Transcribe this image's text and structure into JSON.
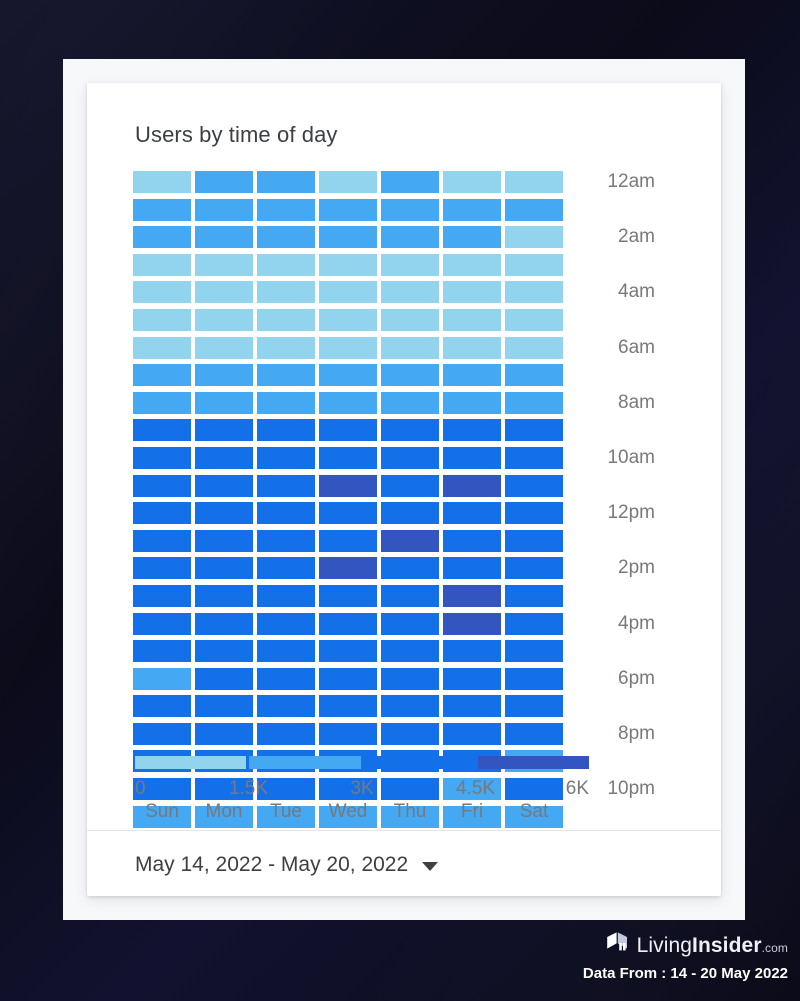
{
  "card": {
    "title": "Users by time of day",
    "date_range_label": "May 14, 2022 - May 20, 2022",
    "caret_icon": "chevron-down-icon"
  },
  "brand": {
    "logo_icon": "living-insider-cube-logo",
    "name_part1": "Living",
    "name_part2": "Insider",
    "name_suffix": ".com",
    "data_from": "Data From : 14 - 20 May 2022"
  },
  "colors": {
    "background": "#0c0c1e",
    "frame": "#f7f8fa",
    "card": "#ffffff",
    "title_text": "#3c4043",
    "axis_text": "#77797c",
    "bucket_1": "#92d3ed",
    "bucket_2": "#44a8f2",
    "bucket_3": "#1470e8",
    "bucket_4": "#3355c0"
  },
  "chart_data": {
    "type": "heatmap",
    "title": "Users by time of day",
    "xlabel": "",
    "ylabel": "",
    "x_categories": [
      "Sun",
      "Mon",
      "Tue",
      "Wed",
      "Thu",
      "Fri",
      "Sat"
    ],
    "y_categories": [
      "12am",
      "1am",
      "2am",
      "3am",
      "4am",
      "5am",
      "6am",
      "7am",
      "8am",
      "9am",
      "10am",
      "11am",
      "12pm",
      "1pm",
      "2pm",
      "3pm",
      "4pm",
      "5pm",
      "6pm",
      "7pm",
      "8pm",
      "9pm",
      "10pm",
      "11pm"
    ],
    "y_tick_labels": [
      "12am",
      "",
      "2am",
      "",
      "4am",
      "",
      "6am",
      "",
      "8am",
      "",
      "10am",
      "",
      "12pm",
      "",
      "2pm",
      "",
      "4pm",
      "",
      "6pm",
      "",
      "8pm",
      "",
      "10pm",
      ""
    ],
    "legend": {
      "position": "bottom",
      "ticks": [
        "0",
        "1.5K",
        "3K",
        "4.5K",
        "6K"
      ],
      "band_colors": [
        "#92d3ed",
        "#44a8f2",
        "#1470e8",
        "#3355c0"
      ],
      "band_ranges": [
        [
          0,
          1500
        ],
        [
          1500,
          3000
        ],
        [
          3000,
          4500
        ],
        [
          4500,
          6000
        ]
      ]
    },
    "value_bucket_scale": [
      1,
      2,
      3,
      4
    ],
    "bucket_colors": [
      "#92d3ed",
      "#44a8f2",
      "#1470e8",
      "#3355c0"
    ],
    "rows": [
      {
        "hour": "12am",
        "buckets": [
          1,
          2,
          2,
          1,
          2,
          1,
          1
        ]
      },
      {
        "hour": "1am",
        "buckets": [
          2,
          2,
          2,
          2,
          2,
          2,
          2
        ]
      },
      {
        "hour": "2am",
        "buckets": [
          2,
          2,
          2,
          2,
          2,
          2,
          1
        ]
      },
      {
        "hour": "3am",
        "buckets": [
          1,
          1,
          1,
          1,
          1,
          1,
          1
        ]
      },
      {
        "hour": "4am",
        "buckets": [
          1,
          1,
          1,
          1,
          1,
          1,
          1
        ]
      },
      {
        "hour": "5am",
        "buckets": [
          1,
          1,
          1,
          1,
          1,
          1,
          1
        ]
      },
      {
        "hour": "6am",
        "buckets": [
          1,
          1,
          1,
          1,
          1,
          1,
          1
        ]
      },
      {
        "hour": "7am",
        "buckets": [
          2,
          2,
          2,
          2,
          2,
          2,
          2
        ]
      },
      {
        "hour": "8am",
        "buckets": [
          2,
          2,
          2,
          2,
          2,
          2,
          2
        ]
      },
      {
        "hour": "9am",
        "buckets": [
          3,
          3,
          3,
          3,
          3,
          3,
          3
        ]
      },
      {
        "hour": "10am",
        "buckets": [
          3,
          3,
          3,
          3,
          3,
          3,
          3
        ]
      },
      {
        "hour": "11am",
        "buckets": [
          3,
          3,
          3,
          4,
          3,
          4,
          3
        ]
      },
      {
        "hour": "12pm",
        "buckets": [
          3,
          3,
          3,
          3,
          3,
          3,
          3
        ]
      },
      {
        "hour": "1pm",
        "buckets": [
          3,
          3,
          3,
          3,
          4,
          3,
          3
        ]
      },
      {
        "hour": "2pm",
        "buckets": [
          3,
          3,
          3,
          4,
          3,
          3,
          3
        ]
      },
      {
        "hour": "3pm",
        "buckets": [
          3,
          3,
          3,
          3,
          3,
          4,
          3
        ]
      },
      {
        "hour": "4pm",
        "buckets": [
          3,
          3,
          3,
          3,
          3,
          4,
          3
        ]
      },
      {
        "hour": "5pm",
        "buckets": [
          3,
          3,
          3,
          3,
          3,
          3,
          3
        ]
      },
      {
        "hour": "6pm",
        "buckets": [
          2,
          3,
          3,
          3,
          3,
          3,
          3
        ]
      },
      {
        "hour": "7pm",
        "buckets": [
          3,
          3,
          3,
          3,
          3,
          3,
          3
        ]
      },
      {
        "hour": "8pm",
        "buckets": [
          3,
          3,
          3,
          3,
          3,
          3,
          3
        ]
      },
      {
        "hour": "9pm",
        "buckets": [
          3,
          3,
          3,
          3,
          3,
          3,
          2
        ]
      },
      {
        "hour": "10pm",
        "buckets": [
          3,
          3,
          3,
          3,
          3,
          2,
          3
        ]
      },
      {
        "hour": "11pm",
        "buckets": [
          2,
          2,
          2,
          2,
          2,
          2,
          2
        ]
      }
    ]
  }
}
